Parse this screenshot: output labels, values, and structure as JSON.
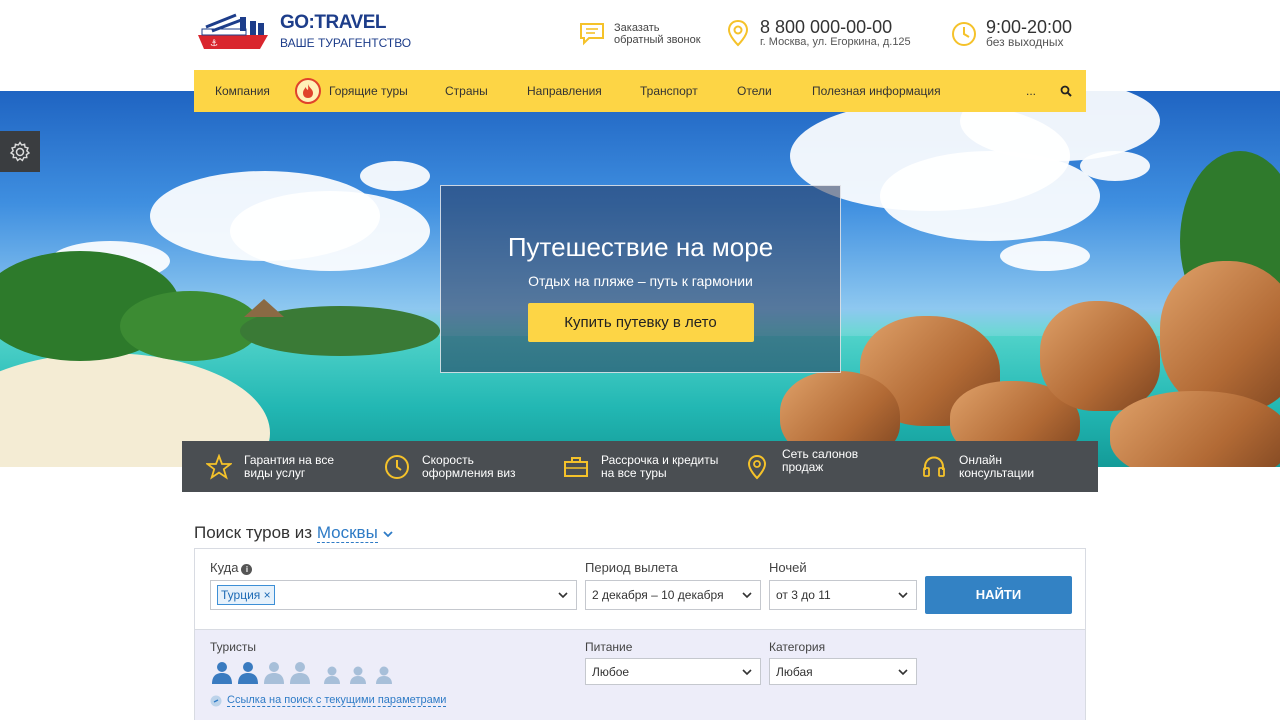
{
  "header": {
    "logo_title": "GO:TRAVEL",
    "logo_subtitle": "ВАШЕ ТУРАГЕНТСТВО",
    "callback_line1": "Заказать",
    "callback_line2": "обратный звонок",
    "phone": "8 800 000-00-00",
    "address": "г. Москва, ул. Егоркина, д.125",
    "hours": "9:00-20:00",
    "hours_note": "без выходных"
  },
  "nav": {
    "items": [
      "Компания",
      "Горящие туры",
      "Страны",
      "Направления",
      "Транспорт",
      "Отели",
      "Полезная информация",
      "..."
    ]
  },
  "hero": {
    "title": "Путешествие на море",
    "subtitle": "Отдых на пляже – путь к гармонии",
    "button": "Купить путевку в лето"
  },
  "features": [
    {
      "line1": "Гарантия на все",
      "line2": "виды услуг",
      "icon": "star-icon"
    },
    {
      "line1": "Скорость",
      "line2": "оформления виз",
      "icon": "clock-icon"
    },
    {
      "line1": "Рассрочка и кредиты",
      "line2": "на все туры",
      "icon": "briefcase-icon"
    },
    {
      "line1": "Сеть салонов продаж",
      "line2": "",
      "icon": "map-pin-icon"
    },
    {
      "line1": "Онлайн",
      "line2": "консультации",
      "icon": "headset-icon"
    }
  ],
  "search": {
    "title_prefix": "Поиск туров из",
    "city": "Москвы",
    "where_label": "Куда",
    "where_tag": "Турция",
    "period_label": "Период вылета",
    "period_value": "2 декабря – 10 декабря",
    "nights_label": "Ночей",
    "nights_value": "от 3 до 11",
    "find_button": "НАЙТИ",
    "tourists_label": "Туристы",
    "meal_label": "Питание",
    "meal_value": "Любое",
    "category_label": "Категория",
    "category_value": "Любая",
    "link_text": "Ссылка на поиск с текущими параметрами"
  },
  "colors": {
    "accent_yellow": "#fdd545",
    "brand_blue": "#1d3d8a",
    "button_blue": "#3382c4",
    "feature_bar": "#4a4e52"
  }
}
